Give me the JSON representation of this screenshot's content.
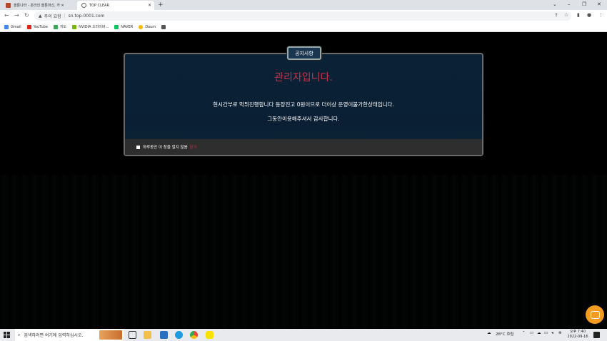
{
  "browser": {
    "tabs": [
      {
        "label": "쏠툰나라 - 온라인 쏠툰마신, 카 ✕"
      },
      {
        "label": "TOP CLEAR"
      }
    ],
    "new_tab": "+",
    "window_controls": [
      "⌄",
      "–",
      "❐",
      "✕"
    ],
    "address": {
      "warning": "주의 요함",
      "url": "sn.top-0001.com"
    },
    "bookmarks": [
      "Gmail",
      "YouTube",
      "지도",
      "NVIDIA 드라이버...",
      "NAVER",
      "Daum"
    ]
  },
  "popup": {
    "badge": "공지사항",
    "title": "관리자입니다.",
    "line1": "현시간부로 먹튀진행합니다 동장진고 0원이므로 더이상 운영이불가한상태입니다.",
    "line2": "그동안이용해주셔서 감사합니다.",
    "footer_text": "하루동안 이 창을 열지 않음",
    "footer_close": "닫기"
  },
  "taskbar": {
    "search_placeholder": "검색하려면 여기에 입력하십시오.",
    "weather": "28°C 흐림",
    "time": "오후 7:40",
    "date": "2022-09-16"
  },
  "colors": {
    "accent_red": "#d0304a",
    "popup_bg": "#0b2236",
    "chat_orange": "#f39c21"
  }
}
